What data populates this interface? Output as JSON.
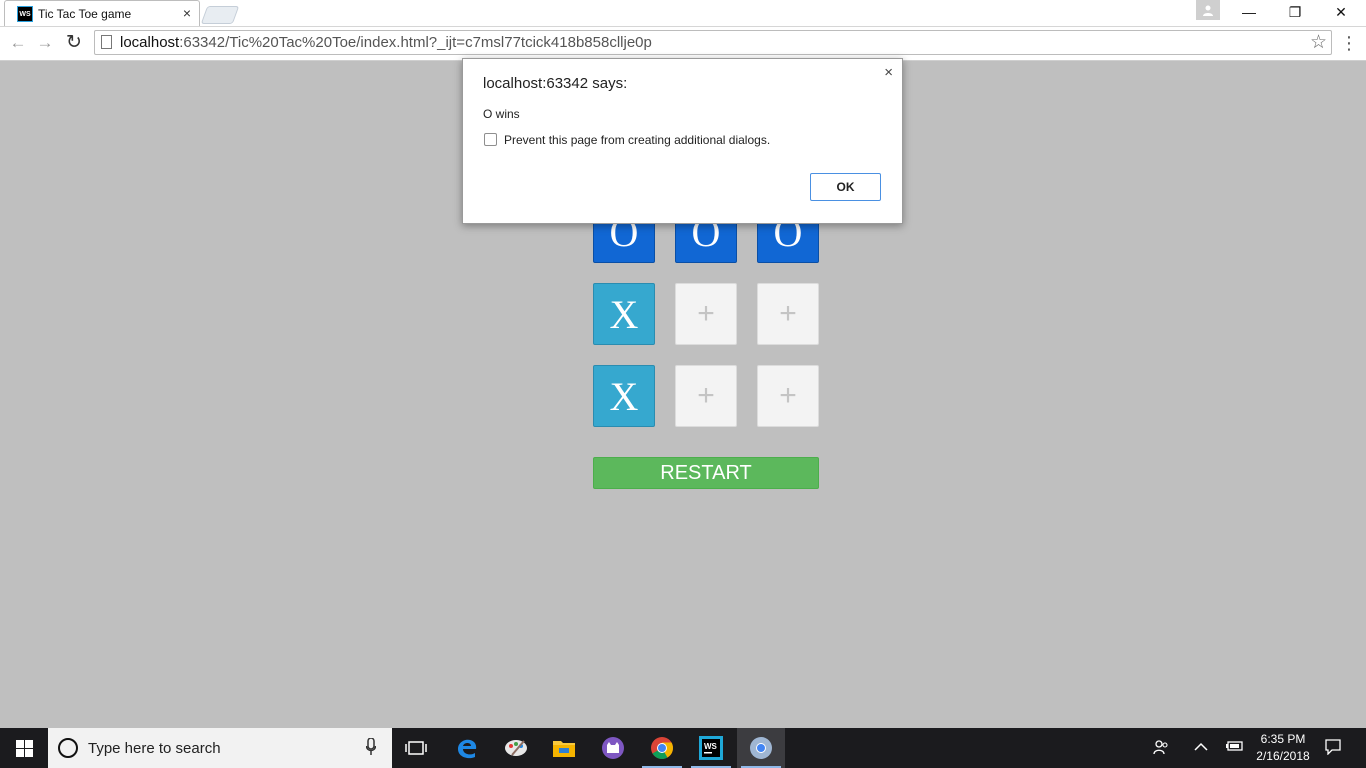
{
  "browser": {
    "tab_title": "Tic Tac Toe game",
    "tab_favicon_text": "WS",
    "tab_close": "×",
    "url_host": "localhost",
    "url_rest": ":63342/Tic%20Tac%20Toe/index.html?_ijt=c7msl77tcick418b858cllje0p",
    "window_buttons": {
      "minimize": "—",
      "restore": "❐",
      "close": "✕"
    },
    "nav": {
      "back": "←",
      "forward": "→",
      "reload": "↻"
    },
    "star": "☆",
    "menu": "⋮"
  },
  "game": {
    "board": [
      [
        "O",
        "O",
        "O"
      ],
      [
        "X",
        "+",
        "+"
      ],
      [
        "X",
        "+",
        "+"
      ]
    ],
    "restart_label": "RESTART"
  },
  "dialog": {
    "title": "localhost:63342 says:",
    "message": "O wins",
    "checkbox_label": "Prevent this page from creating additional dialogs.",
    "ok_label": "OK",
    "close": "×"
  },
  "taskbar": {
    "search_placeholder": "Type here to search",
    "time": "6:35 PM",
    "date": "2/16/2018",
    "pinned_apps": [
      "task-view",
      "edge",
      "paint",
      "file-explorer",
      "github-desktop",
      "chrome",
      "webstorm",
      "chrome-canary"
    ]
  },
  "colors": {
    "page_background": "#bfbfbf",
    "o_cell": "#1167d4",
    "x_cell": "#36a8cf",
    "restart": "#5cb85c",
    "ok_border": "#4a90e2"
  }
}
